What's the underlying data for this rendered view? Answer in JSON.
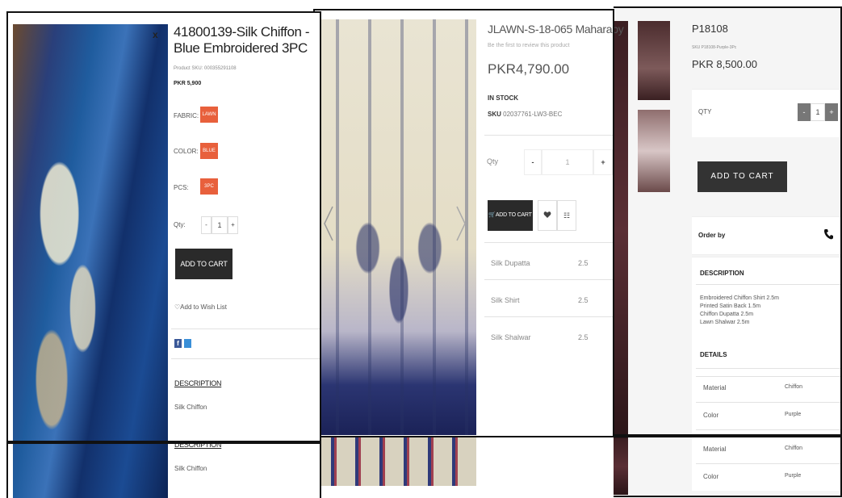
{
  "panel1": {
    "title": "41800139-Silk Chiffon - Blue Embroidered 3PC",
    "sku": "Product SKU: 000355291108",
    "price": "PKR 5,900",
    "fabric_label": "FABRIC:",
    "fabric_value": "LAWN",
    "color_label": "COLOR:",
    "color_value": "BLUE",
    "pcs_label": "PCS:",
    "pcs_value": "3PC",
    "qty_label": "Qty:",
    "qty_minus": "-",
    "qty_value": "1",
    "qty_plus": "+",
    "add_to_cart": "ADD TO CART",
    "wishlist": "Add to Wish List",
    "wishlist_icon": "heart-outline-icon",
    "share_icons": [
      "facebook-icon",
      "twitter-icon"
    ],
    "description_heading": "DESCRIPTION",
    "description_text": "Silk Chiffon",
    "description_heading_dup": "DESCRIPTION",
    "description_text_dup": "Silk Chiffon",
    "close_symbol": "x",
    "accent_color": "#e8603c"
  },
  "panel2": {
    "title": "JLAWN-S-18-065 Maharaby",
    "review_prompt": "Be the first to review this product",
    "price": "PKR4,790.00",
    "stock": "IN STOCK",
    "sku_label": "SKU",
    "sku_value": "02037761-LW3-BEC",
    "qty_label": "Qty",
    "qty_minus": "-",
    "qty_value": "1",
    "qty_plus": "+",
    "add_to_cart": "ADD TO CART",
    "wishlist_icon": "heart-icon",
    "compare_icon": "compare-icon",
    "specs": [
      {
        "name": "Silk Dupatta",
        "value": "2.5"
      },
      {
        "name": "Silk Shirt",
        "value": "2.5"
      },
      {
        "name": "Silk Shalwar",
        "value": "2.5"
      }
    ]
  },
  "panel3": {
    "title": "P18108",
    "sku": "SKU P18108-Purple-3Pc",
    "price": "PKR 8,500.00",
    "qty_label": "QTY",
    "qty_minus": "-",
    "qty_value": "1",
    "qty_plus": "+",
    "add_to_cart": "ADD TO CART",
    "order_by": "Order by",
    "phone_icon": "phone-icon",
    "description_heading": "DESCRIPTION",
    "description_lines": [
      "Embroidered Chiffon Shirt 2.5m",
      "Printed Satin Back 1.5m",
      "Chiffon Dupatta 2.5m",
      "Lawn Shalwar 2.5m"
    ],
    "details_heading": "DETAILS",
    "details": [
      {
        "name": "Material",
        "value": "Chiffon"
      },
      {
        "name": "Color",
        "value": "Purple"
      }
    ],
    "details_dup": [
      {
        "name": "Material",
        "value": "Chiffon"
      },
      {
        "name": "Color",
        "value": "Purple"
      }
    ]
  }
}
